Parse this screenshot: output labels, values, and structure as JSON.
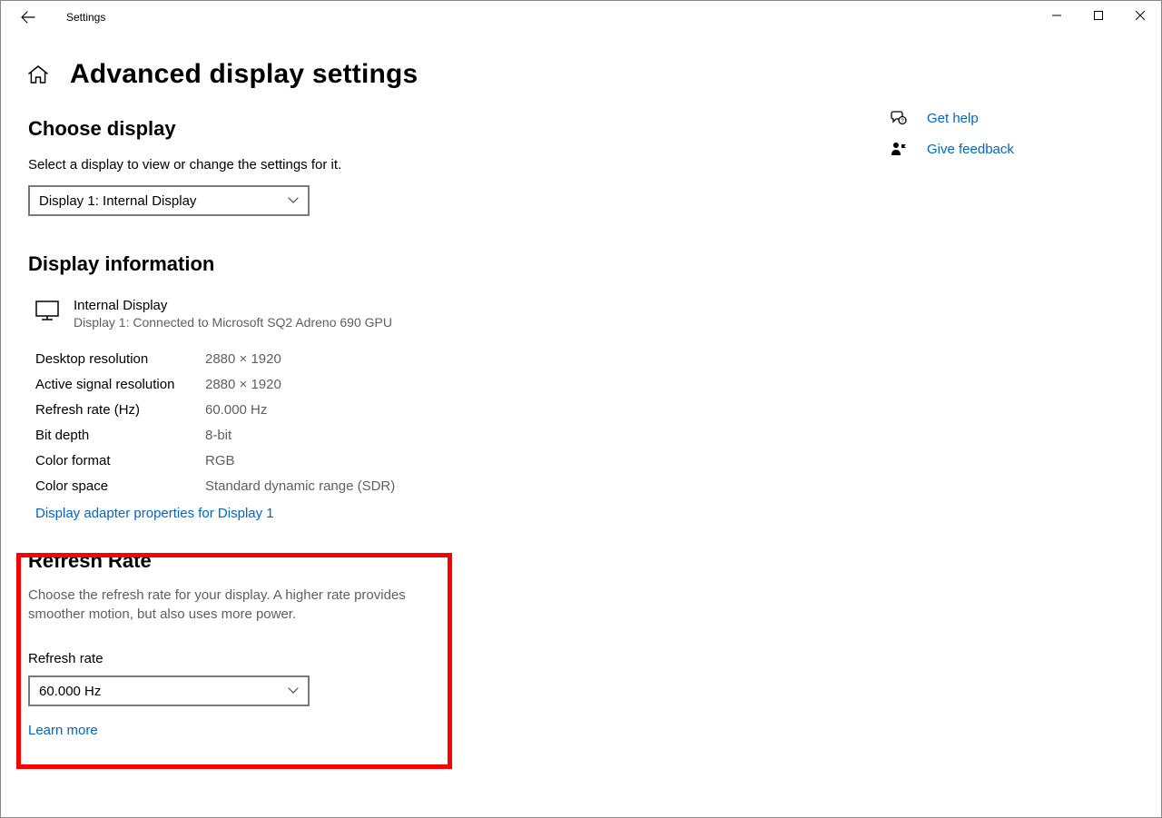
{
  "titlebar": {
    "app_title": "Settings"
  },
  "page": {
    "title": "Advanced display settings"
  },
  "choose_display": {
    "heading": "Choose display",
    "instruction": "Select a display to view or change the settings for it.",
    "selected": "Display 1: Internal Display"
  },
  "display_info": {
    "heading": "Display information",
    "hero_name": "Internal Display",
    "hero_subtitle": "Display 1: Connected to Microsoft SQ2 Adreno 690 GPU",
    "rows": [
      {
        "label": "Desktop resolution",
        "value": "2880 × 1920"
      },
      {
        "label": "Active signal resolution",
        "value": "2880 × 1920"
      },
      {
        "label": "Refresh rate (Hz)",
        "value": "60.000 Hz"
      },
      {
        "label": "Bit depth",
        "value": "8-bit"
      },
      {
        "label": "Color format",
        "value": "RGB"
      },
      {
        "label": "Color space",
        "value": "Standard dynamic range (SDR)"
      }
    ],
    "adapter_link": "Display adapter properties for Display 1"
  },
  "refresh_rate": {
    "heading": "Refresh Rate",
    "description": "Choose the refresh rate for your display. A higher rate provides smoother motion, but also uses more power.",
    "field_label": "Refresh rate",
    "selected": "60.000 Hz",
    "learn_more": "Learn more"
  },
  "side": {
    "get_help": "Get help",
    "feedback": "Give feedback"
  }
}
